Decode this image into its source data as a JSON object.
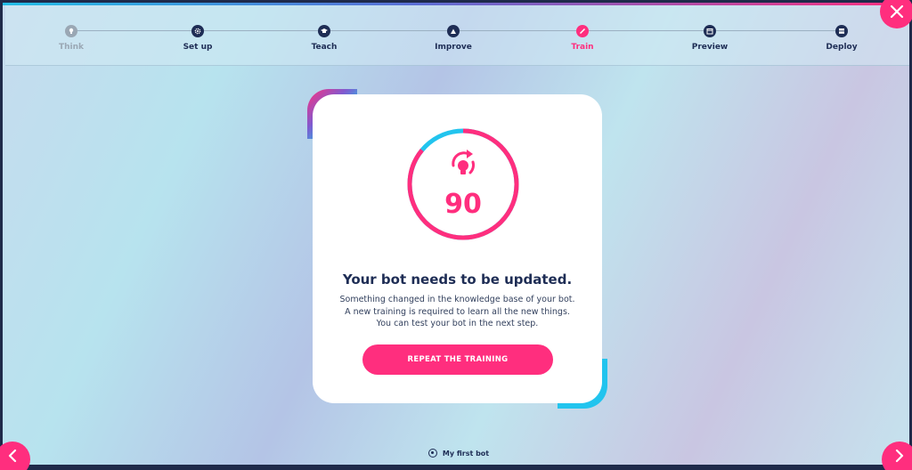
{
  "stepper": {
    "steps": [
      {
        "label": "Think",
        "icon": "lightbulb-icon",
        "state": "done"
      },
      {
        "label": "Set up",
        "icon": "gear-icon",
        "state": "pending"
      },
      {
        "label": "Teach",
        "icon": "graduation-cap-icon",
        "state": "pending"
      },
      {
        "label": "Improve",
        "icon": "mountain-icon",
        "state": "pending"
      },
      {
        "label": "Train",
        "icon": "pencil-icon",
        "state": "active"
      },
      {
        "label": "Preview",
        "icon": "calendar-icon",
        "state": "pending"
      },
      {
        "label": "Deploy",
        "icon": "server-icon",
        "state": "pending"
      }
    ]
  },
  "card": {
    "score": "90",
    "score_progress": 0.86,
    "title": "Your bot needs to be updated.",
    "lines": [
      "Something changed in the knowledge base of your bot.",
      "A new training is required to learn all the new things.",
      "You can test your bot in the next step."
    ],
    "button_label": "REPEAT THE TRAINING"
  },
  "footer": {
    "bot_name": "My first bot"
  },
  "colors": {
    "accent": "#ff2e7e",
    "navy": "#1e2d55",
    "cyan": "#22c4ee",
    "done": "#9aa7b4"
  }
}
